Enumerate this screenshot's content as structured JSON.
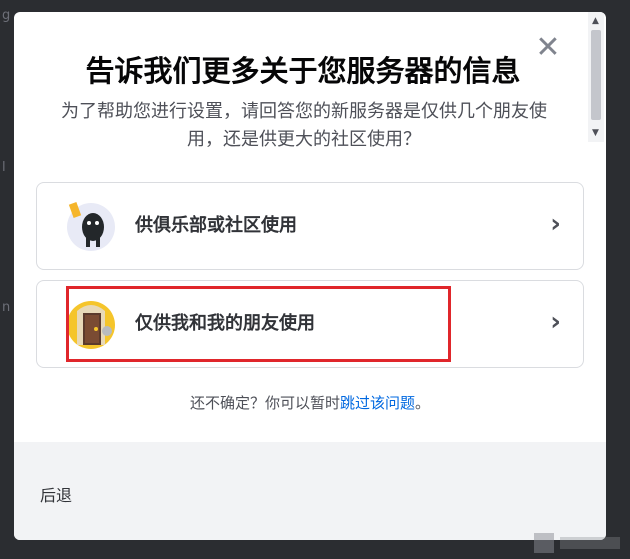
{
  "modal": {
    "title": "告诉我们更多关于您服务器的信息",
    "subtitle": "为了帮助您进行设置，请回答您的新服务器是仅供几个朋友使用，还是供更大的社区使用？",
    "close_icon": "close-icon",
    "options": [
      {
        "label": "供俱乐部或社区使用",
        "icon": "club-community-illustration",
        "chevron": "›"
      },
      {
        "label": "仅供我和我的朋友使用",
        "icon": "friends-door-illustration",
        "chevron": "›"
      }
    ],
    "hint_prefix": "还不确定？你可以暂时",
    "hint_link": "跳过该问题",
    "hint_suffix": "。",
    "back_label": "后退"
  },
  "colors": {
    "accent_link": "#0068e0",
    "highlight_border": "#e0262b",
    "modal_bg": "#ffffff",
    "footer_bg": "#f2f3f5"
  }
}
